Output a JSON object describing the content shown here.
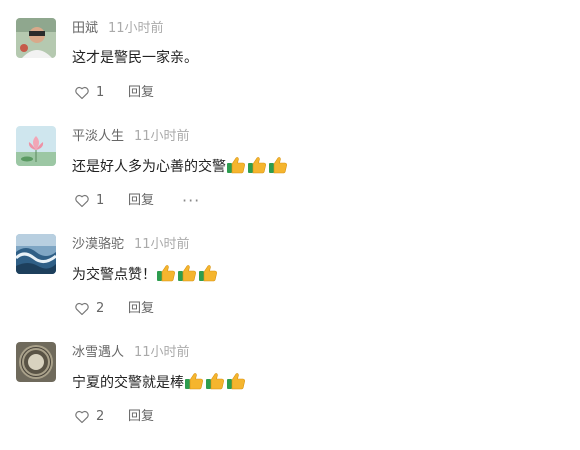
{
  "comments": [
    {
      "username": "田斌",
      "time": "11小时前",
      "text": "这才是警民一家亲。",
      "thumbs": 0,
      "likes": "1",
      "reply_label": "回复",
      "more_label": "",
      "avatar": "avatar-person",
      "like_icon": "heart-outline-icon"
    },
    {
      "username": "平淡人生",
      "time": "11小时前",
      "text": "还是好人多为心善的交警",
      "thumbs": 3,
      "likes": "1",
      "reply_label": "回复",
      "more_label": "···",
      "avatar": "avatar-lotus",
      "like_icon": "heart-outline-icon"
    },
    {
      "username": "沙漠骆驼",
      "time": "11小时前",
      "text": "为交警点赞！",
      "thumbs": 3,
      "likes": "2",
      "reply_label": "回复",
      "more_label": "",
      "avatar": "avatar-waves",
      "like_icon": "heart-outline-icon"
    },
    {
      "username": "冰雪遇人",
      "time": "11小时前",
      "text": "宁夏的交警就是棒",
      "thumbs": 3,
      "likes": "2",
      "reply_label": "回复",
      "more_label": "",
      "avatar": "avatar-tulou",
      "like_icon": "heart-outline-icon"
    }
  ],
  "colors": {
    "username": "#666666",
    "time": "#aaaaaa",
    "content": "#222222",
    "thumb_yellow": "#f5b52e",
    "thumb_green": "#2e9d4f"
  },
  "emoji_icon": "thumbs-up-icon"
}
